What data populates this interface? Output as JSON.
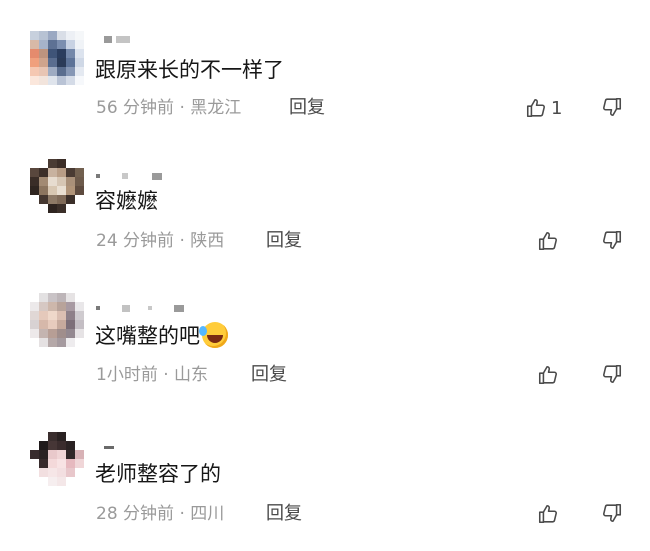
{
  "comments": [
    {
      "text": "跟原来长的不一样了",
      "meta": "56 分钟前 · 黑龙江",
      "reply_label": "回复",
      "like_count": "1",
      "emoji": false
    },
    {
      "text": "容嬷嬷",
      "meta": "24 分钟前 · 陕西",
      "reply_label": "回复",
      "like_count": "",
      "emoji": false
    },
    {
      "text": "这嘴整的吧",
      "meta": "1小时前 · 山东",
      "reply_label": "回复",
      "like_count": "",
      "emoji": true,
      "emoji_icon": "rolling-laughing-emoji"
    },
    {
      "text": "老师整容了的",
      "meta": "28 分钟前 · 四川",
      "reply_label": "回复",
      "like_count": "",
      "emoji": false
    }
  ],
  "icons": {
    "like": "thumbs-up-icon",
    "dislike": "thumbs-down-icon"
  },
  "colors": {
    "text": "#161616",
    "meta": "#9a9a9a",
    "action": "#4a4a4a",
    "background": "#ffffff"
  }
}
